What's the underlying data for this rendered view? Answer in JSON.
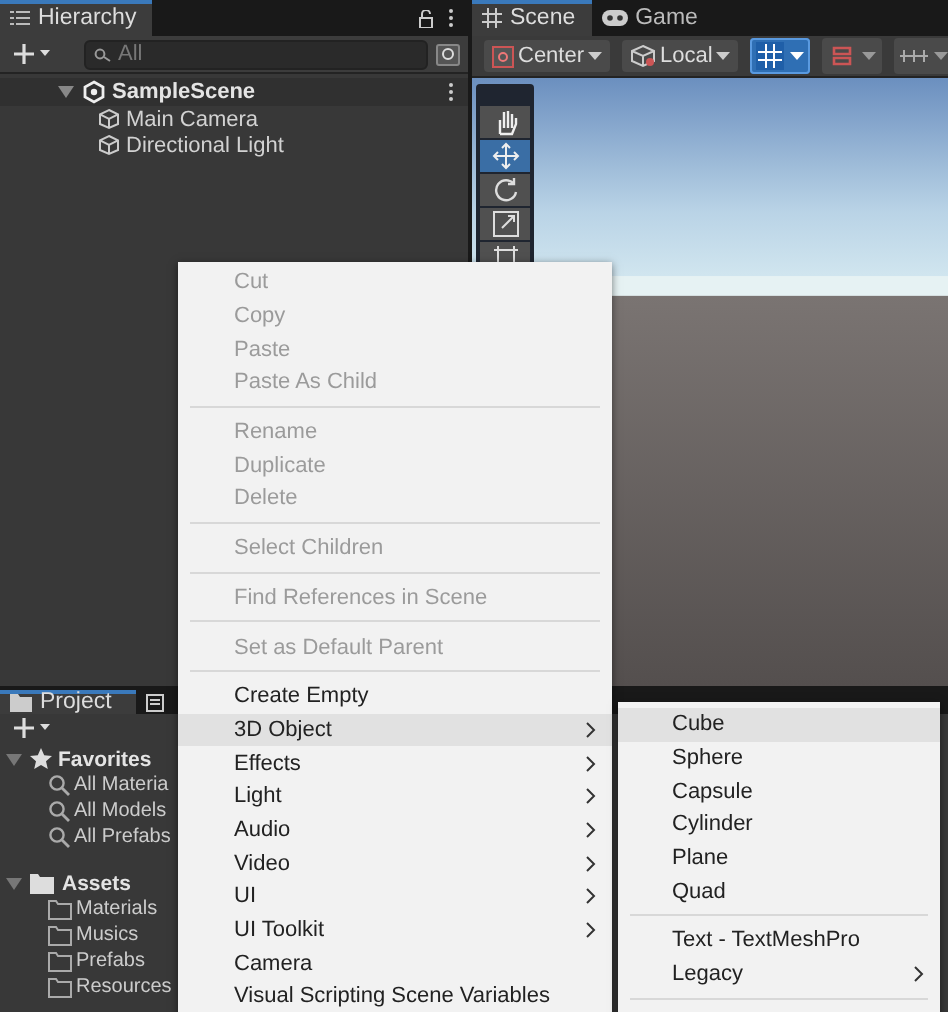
{
  "hierarchy": {
    "title": "Hierarchy",
    "search": {
      "placeholder": "All"
    },
    "scene": {
      "name": "SampleScene",
      "expanded": true,
      "children": [
        {
          "name": "Main Camera"
        },
        {
          "name": "Directional Light"
        }
      ]
    }
  },
  "scene_view": {
    "tabs": [
      {
        "label": "Scene",
        "kind": "scene",
        "selected": true
      },
      {
        "label": "Game",
        "kind": "game",
        "selected": false
      }
    ],
    "pivot": "Center",
    "space": "Local",
    "toggles": [
      {
        "kind": "grid",
        "on": true
      },
      {
        "kind": "snap",
        "on": false
      },
      {
        "kind": "ruler",
        "on": false
      }
    ],
    "tools": [
      {
        "kind": "hand",
        "selected": false
      },
      {
        "kind": "move",
        "selected": true
      },
      {
        "kind": "rotate",
        "selected": false
      },
      {
        "kind": "scale",
        "selected": false
      },
      {
        "kind": "rect",
        "selected": false
      }
    ]
  },
  "project": {
    "tabs": [
      {
        "label": "Project",
        "selected": true
      },
      {
        "selected": false
      }
    ],
    "tree": [
      {
        "name": "Favorites",
        "kind": "favorites",
        "expanded": true,
        "children": [
          {
            "name": "All Materia"
          },
          {
            "name": "All Models"
          },
          {
            "name": "All Prefabs"
          }
        ]
      },
      {
        "name": "Assets",
        "kind": "assets",
        "expanded": true,
        "children": [
          {
            "name": "Materials"
          },
          {
            "name": "Musics"
          },
          {
            "name": "Prefabs"
          },
          {
            "name": "Resources"
          }
        ]
      }
    ]
  },
  "context_menu": {
    "items": [
      {
        "kind": "item",
        "label": "Cut",
        "disabled": true,
        "submenu": false,
        "selected": false
      },
      {
        "kind": "item",
        "label": "Copy",
        "disabled": true,
        "submenu": false,
        "selected": false
      },
      {
        "kind": "item",
        "label": "Paste",
        "disabled": true,
        "submenu": false,
        "selected": false
      },
      {
        "kind": "item",
        "label": "Paste As Child",
        "disabled": true,
        "submenu": false,
        "selected": false
      },
      {
        "kind": "separator"
      },
      {
        "kind": "item",
        "label": "Rename",
        "disabled": true,
        "submenu": false,
        "selected": false
      },
      {
        "kind": "item",
        "label": "Duplicate",
        "disabled": true,
        "submenu": false,
        "selected": false
      },
      {
        "kind": "item",
        "label": "Delete",
        "disabled": true,
        "submenu": false,
        "selected": false
      },
      {
        "kind": "separator"
      },
      {
        "kind": "item",
        "label": "Select Children",
        "disabled": true,
        "submenu": false,
        "selected": false
      },
      {
        "kind": "separator"
      },
      {
        "kind": "item",
        "label": "Find References in Scene",
        "disabled": true,
        "submenu": false,
        "selected": false
      },
      {
        "kind": "separator"
      },
      {
        "kind": "item",
        "label": "Set as Default Parent",
        "disabled": true,
        "submenu": false,
        "selected": false
      },
      {
        "kind": "separator"
      },
      {
        "kind": "item",
        "label": "Create Empty",
        "disabled": false,
        "submenu": false,
        "selected": false
      },
      {
        "kind": "item",
        "label": "3D Object",
        "disabled": false,
        "submenu": true,
        "selected": true
      },
      {
        "kind": "item",
        "label": "Effects",
        "disabled": false,
        "submenu": true,
        "selected": false
      },
      {
        "kind": "item",
        "label": "Light",
        "disabled": false,
        "submenu": true,
        "selected": false
      },
      {
        "kind": "item",
        "label": "Audio",
        "disabled": false,
        "submenu": true,
        "selected": false
      },
      {
        "kind": "item",
        "label": "Video",
        "disabled": false,
        "submenu": true,
        "selected": false
      },
      {
        "kind": "item",
        "label": "UI",
        "disabled": false,
        "submenu": true,
        "selected": false
      },
      {
        "kind": "item",
        "label": "UI Toolkit",
        "disabled": false,
        "submenu": true,
        "selected": false
      },
      {
        "kind": "item",
        "label": "Camera",
        "disabled": false,
        "submenu": false,
        "selected": false
      },
      {
        "kind": "item",
        "label": "Visual Scripting Scene Variables",
        "disabled": false,
        "submenu": false,
        "selected": false
      }
    ]
  },
  "submenu": {
    "items": [
      {
        "kind": "item",
        "label": "Cube",
        "disabled": false,
        "submenu": false,
        "selected": true
      },
      {
        "kind": "item",
        "label": "Sphere",
        "disabled": false,
        "submenu": false,
        "selected": false
      },
      {
        "kind": "item",
        "label": "Capsule",
        "disabled": false,
        "submenu": false,
        "selected": false
      },
      {
        "kind": "item",
        "label": "Cylinder",
        "disabled": false,
        "submenu": false,
        "selected": false
      },
      {
        "kind": "item",
        "label": "Plane",
        "disabled": false,
        "submenu": false,
        "selected": false
      },
      {
        "kind": "item",
        "label": "Quad",
        "disabled": false,
        "submenu": false,
        "selected": false
      },
      {
        "kind": "separator"
      },
      {
        "kind": "item",
        "label": "Text - TextMeshPro",
        "disabled": false,
        "submenu": false,
        "selected": false
      },
      {
        "kind": "item",
        "label": "Legacy",
        "disabled": false,
        "submenu": true,
        "selected": false
      },
      {
        "kind": "separator"
      }
    ]
  }
}
